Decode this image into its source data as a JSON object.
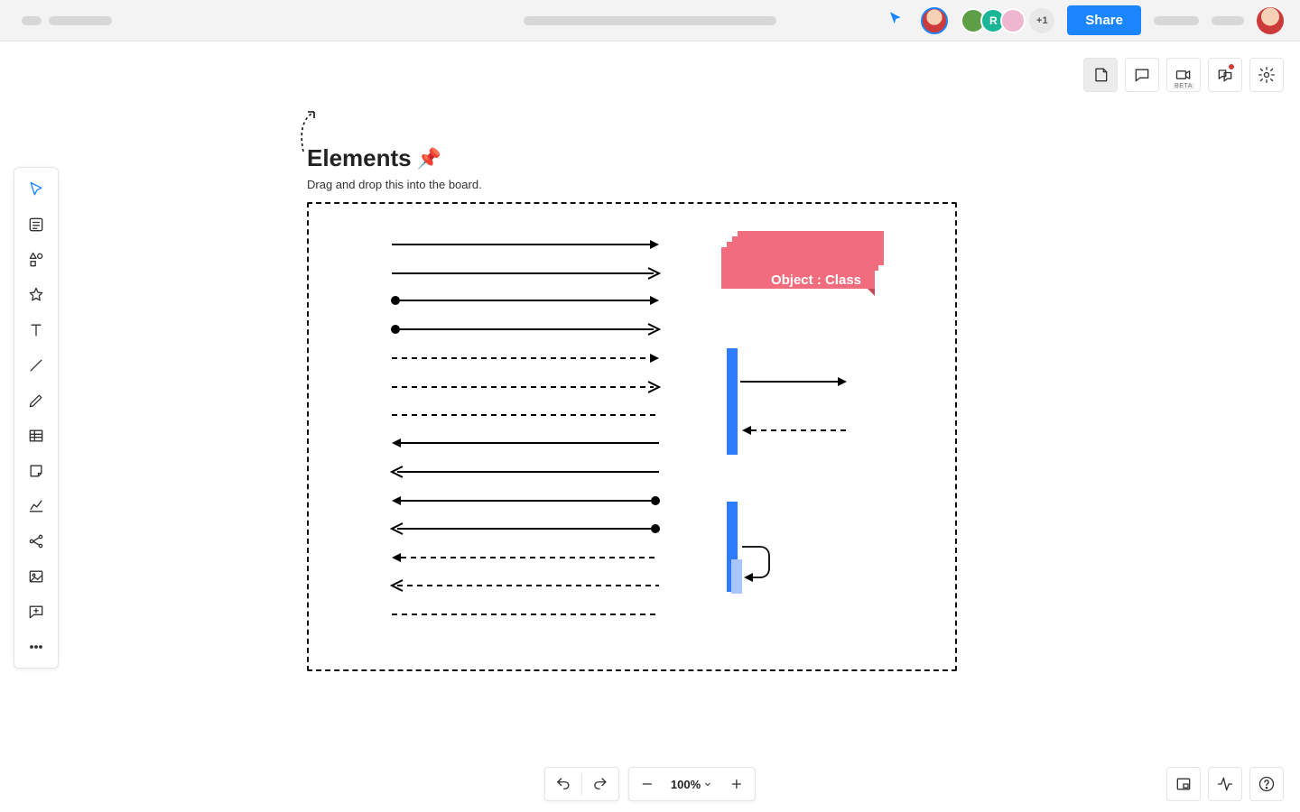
{
  "topbar": {
    "share_label": "Share",
    "more_collaborators": "+1",
    "letter_avatar": "R"
  },
  "action": {
    "beta_label": "BETA"
  },
  "canvas": {
    "heading": "Elements",
    "subheading": "Drag and drop this into the board.",
    "object_label": "Object : Class"
  },
  "bottombar": {
    "zoom": "100%"
  }
}
